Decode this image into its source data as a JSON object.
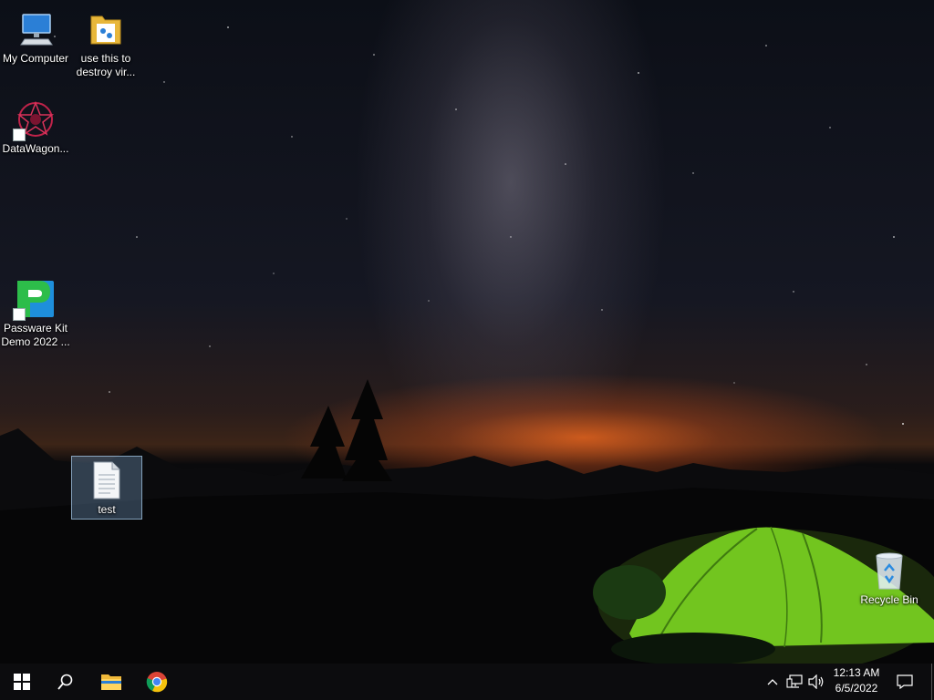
{
  "desktop": {
    "icons": [
      {
        "label": "My Computer",
        "icon": "computer-icon"
      },
      {
        "label": "use this to destroy vir...",
        "icon": "folder-icon"
      },
      {
        "label": "DataWagon...",
        "icon": "datawagon-app-icon",
        "shortcut": true
      },
      {
        "label": "Passware Kit Demo 2022 ...",
        "icon": "passware-app-icon",
        "shortcut": true
      },
      {
        "label": "test",
        "icon": "text-file-icon",
        "selected": true
      },
      {
        "label": "Recycle Bin",
        "icon": "recycle-bin-icon"
      }
    ]
  },
  "taskbar": {
    "buttons": [
      {
        "name": "start-button",
        "icon": "windows-logo-icon"
      },
      {
        "name": "search-button",
        "icon": "search-icon"
      },
      {
        "name": "file-explorer-button",
        "icon": "folder-icon"
      },
      {
        "name": "chrome-button",
        "icon": "chrome-icon"
      }
    ],
    "tray": {
      "icons": [
        "chevron-up-icon",
        "network-icon",
        "volume-icon",
        "notification-icon"
      ],
      "time": "12:13 AM",
      "date": "6/5/2022"
    }
  },
  "colors": {
    "taskbar_bg": "#0c0c0e",
    "tent_green": "#7ed321",
    "horizon_glow": "#e0641e",
    "selection": "#78a0c8"
  }
}
